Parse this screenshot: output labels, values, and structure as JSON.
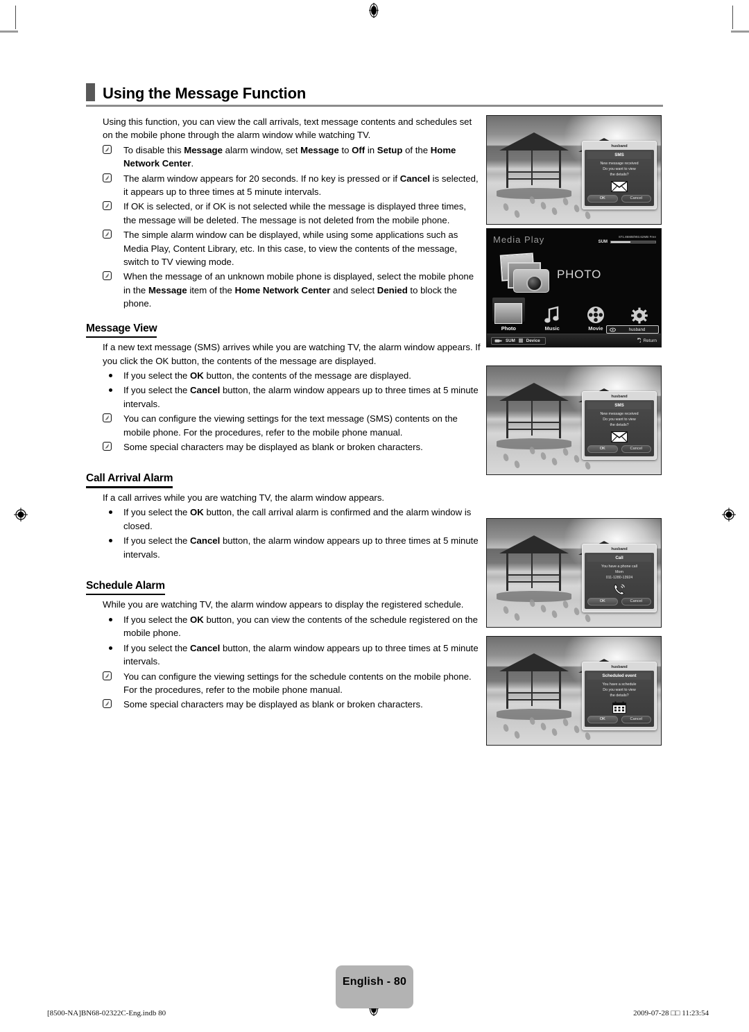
{
  "document": {
    "heading": "Using the Message Function",
    "intro": "Using this function, you can view the call arrivals, text message contents and schedules set on the mobile phone through the alarm window while watching TV."
  },
  "intro_notes": [
    {
      "icon": "note-icon",
      "text": "To disable this Message alarm window, set Message to Off in Setup of the Home Network Center."
    },
    {
      "icon": "note-icon",
      "text": "The alarm window appears for 20 seconds. If no key is pressed or if Cancel is selected, it appears up to three times at 5 minute intervals."
    },
    {
      "icon": "note-icon",
      "text": "If OK is selected, or if OK is not selected while the message is displayed three times, the message will be deleted. The message is not deleted from the mobile phone."
    },
    {
      "icon": "note-icon",
      "text": "The simple alarm window can be displayed, while using some applications such as Media Play, Content Library, etc. In this case, to view the contents of the message, switch to TV viewing mode."
    },
    {
      "icon": "note-icon",
      "text": "When the message of an unknown mobile phone is displayed, select the mobile phone in the Message item of the Home Network Center and select Denied to block the phone."
    }
  ],
  "sections": [
    {
      "title": "Message View",
      "intro": "If a new text message (SMS) arrives while you are watching TV, the alarm window appears. If you click the OK button, the contents of the message are displayed.",
      "items": [
        {
          "icon": "bullet-icon",
          "text": "If you select the OK button, the contents of the message are displayed."
        },
        {
          "icon": "bullet-icon",
          "text": "If you select the Cancel button, the alarm window appears up to three times at 5 minute intervals."
        },
        {
          "icon": "note-icon",
          "text": "You can configure the viewing settings for the text message (SMS) contents on the mobile phone. For the procedures, refer to the mobile phone manual."
        },
        {
          "icon": "note-icon",
          "text": "Some special characters may be displayed as blank or broken characters."
        }
      ]
    },
    {
      "title": "Call Arrival Alarm",
      "intro": "If a call arrives while you are watching TV, the alarm window appears.",
      "items": [
        {
          "icon": "bullet-icon",
          "text": "If you select the OK button, the call arrival alarm is confirmed and the alarm window is closed."
        },
        {
          "icon": "bullet-icon",
          "text": "If you select the Cancel button, the alarm window appears up to three times at 5 minute intervals."
        }
      ]
    },
    {
      "title": "Schedule Alarm",
      "intro": "While you are watching TV, the alarm window appears to display the registered schedule.",
      "items": [
        {
          "icon": "bullet-icon",
          "text": "If you select the OK button, you can view the contents of the schedule registered on the mobile phone."
        },
        {
          "icon": "bullet-icon",
          "text": "If you select the Cancel button, the alarm window appears up to three times at 5 minute intervals."
        },
        {
          "icon": "note-icon",
          "text": "You can configure the viewing settings for the schedule contents on the mobile phone. For the procedures, refer to the mobile phone manual."
        },
        {
          "icon": "note-icon",
          "text": "Some special characters may be displayed as blank or broken characters."
        }
      ]
    }
  ],
  "screenshots": {
    "sms_alarm": {
      "sender": "husband",
      "title": "SMS",
      "line1": "New message received",
      "line2": "Do you want to view",
      "line3": "the details?",
      "icon": "envelope-icon",
      "ok": "OK",
      "cancel": "Cancel"
    },
    "call_alarm": {
      "sender": "husband",
      "title": "Call",
      "line1": "You have a phone call",
      "line2": "Mom",
      "line3": "011-1280-13924",
      "icon": "phone-icon",
      "ok": "OK",
      "cancel": "Cancel"
    },
    "schedule_alarm": {
      "sender": "husband",
      "title": "Scheduled event",
      "line1": "You have a schedule",
      "line2": "Do you want to view",
      "line3": "the details?",
      "icon": "calendar-icon",
      "ok": "OK",
      "cancel": "Cancel"
    },
    "media_play": {
      "title": "Media Play",
      "storage_label": "SUM",
      "storage_free": "871.86MB/993.62MB Free",
      "selected_label": "PHOTO",
      "icons": [
        {
          "name": "Photo",
          "glyph": "photo-icon"
        },
        {
          "name": "Music",
          "glyph": "music-note-icon"
        },
        {
          "name": "Movie",
          "glyph": "film-reel-icon"
        },
        {
          "name": "Setup",
          "glyph": "gear-icon"
        }
      ],
      "tooltip_device": "husband",
      "bottom_left_key": "SUM",
      "bottom_left_label": "Device",
      "bottom_right": "Return"
    }
  },
  "footer": {
    "page_badge": "English - 80",
    "file_info": "[8500-NA]BN68-02322C-Eng.indb   80",
    "timestamp": "2009-07-28   □□ 11:23:54"
  }
}
